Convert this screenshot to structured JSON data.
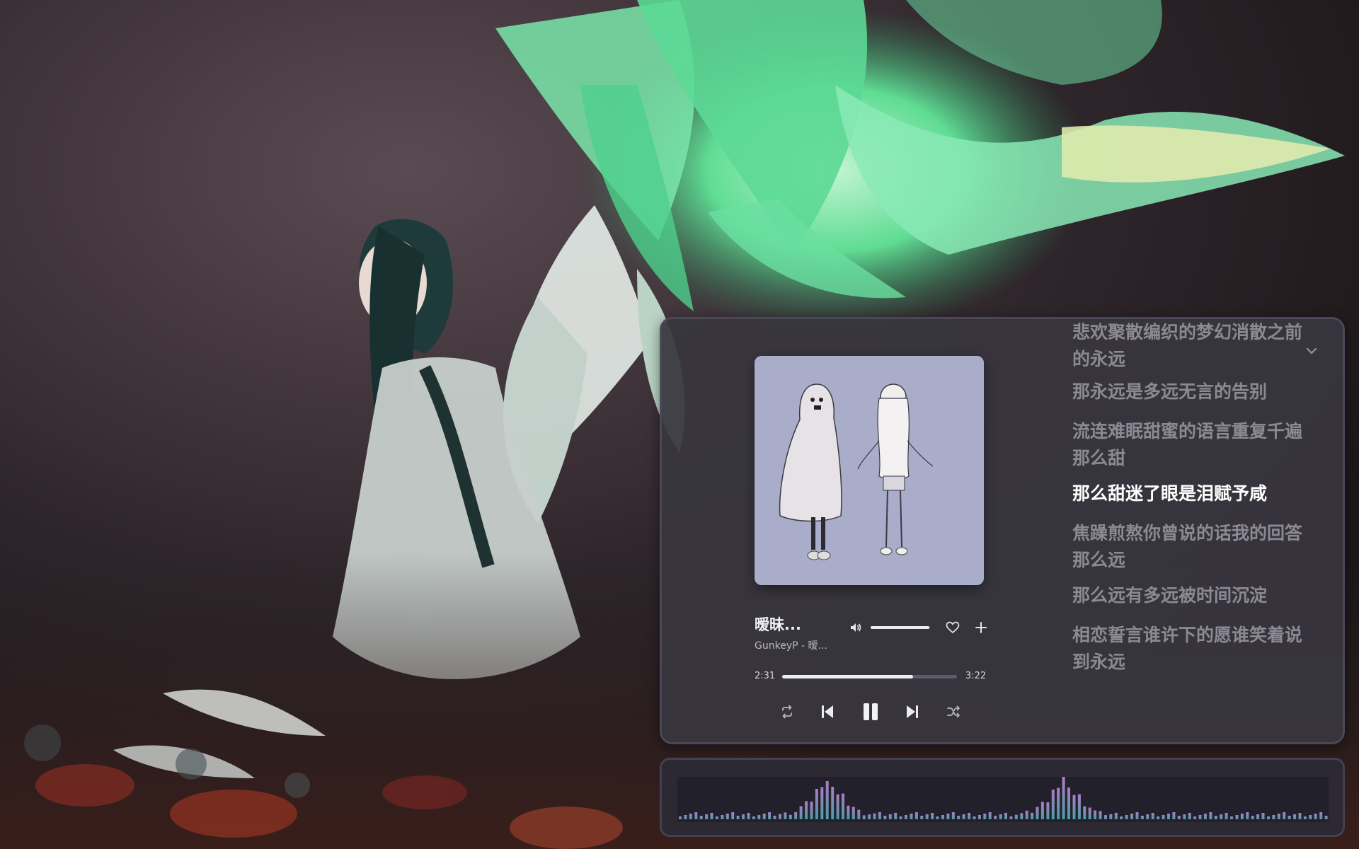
{
  "player": {
    "title": "暧昧...",
    "artist": "GunkeyP - 暧...",
    "time_elapsed": "2:31",
    "time_total": "3:22",
    "progress": 0.749,
    "volume": 0.99,
    "playing": true
  },
  "icons": {
    "volume": "volume-icon",
    "favorite": "heart-icon",
    "add": "plus-icon",
    "repeat": "repeat-icon",
    "previous": "skip-previous-icon",
    "pause": "pause-icon",
    "next": "skip-next-icon",
    "shuffle": "shuffle-icon",
    "collapse": "chevron-down-icon"
  },
  "lyrics": [
    {
      "text": "悲欢聚散编织的梦幻消散之前的永远",
      "active": false
    },
    {
      "text": "那永远是多远无言的告别",
      "active": false
    },
    {
      "text": "流连难眠甜蜜的语言重复千遍那么甜",
      "active": false
    },
    {
      "text": "那么甜迷了眼是泪赋予咸",
      "active": true
    },
    {
      "text": "焦躁煎熬你曾说的话我的回答那么远",
      "active": false
    },
    {
      "text": "那么远有多远被时间沉淀",
      "active": false
    },
    {
      "text": "相恋誓言谁许下的愿谁笑着说到永远",
      "active": false
    }
  ],
  "colors": {
    "panel": "#38363e",
    "lyric_inactive": "#8b8a93",
    "lyric_active": "#ffffff",
    "accent": "#ededf1",
    "wallpaper_bg": "#2b2327",
    "splash_green": "#5fe39a"
  }
}
